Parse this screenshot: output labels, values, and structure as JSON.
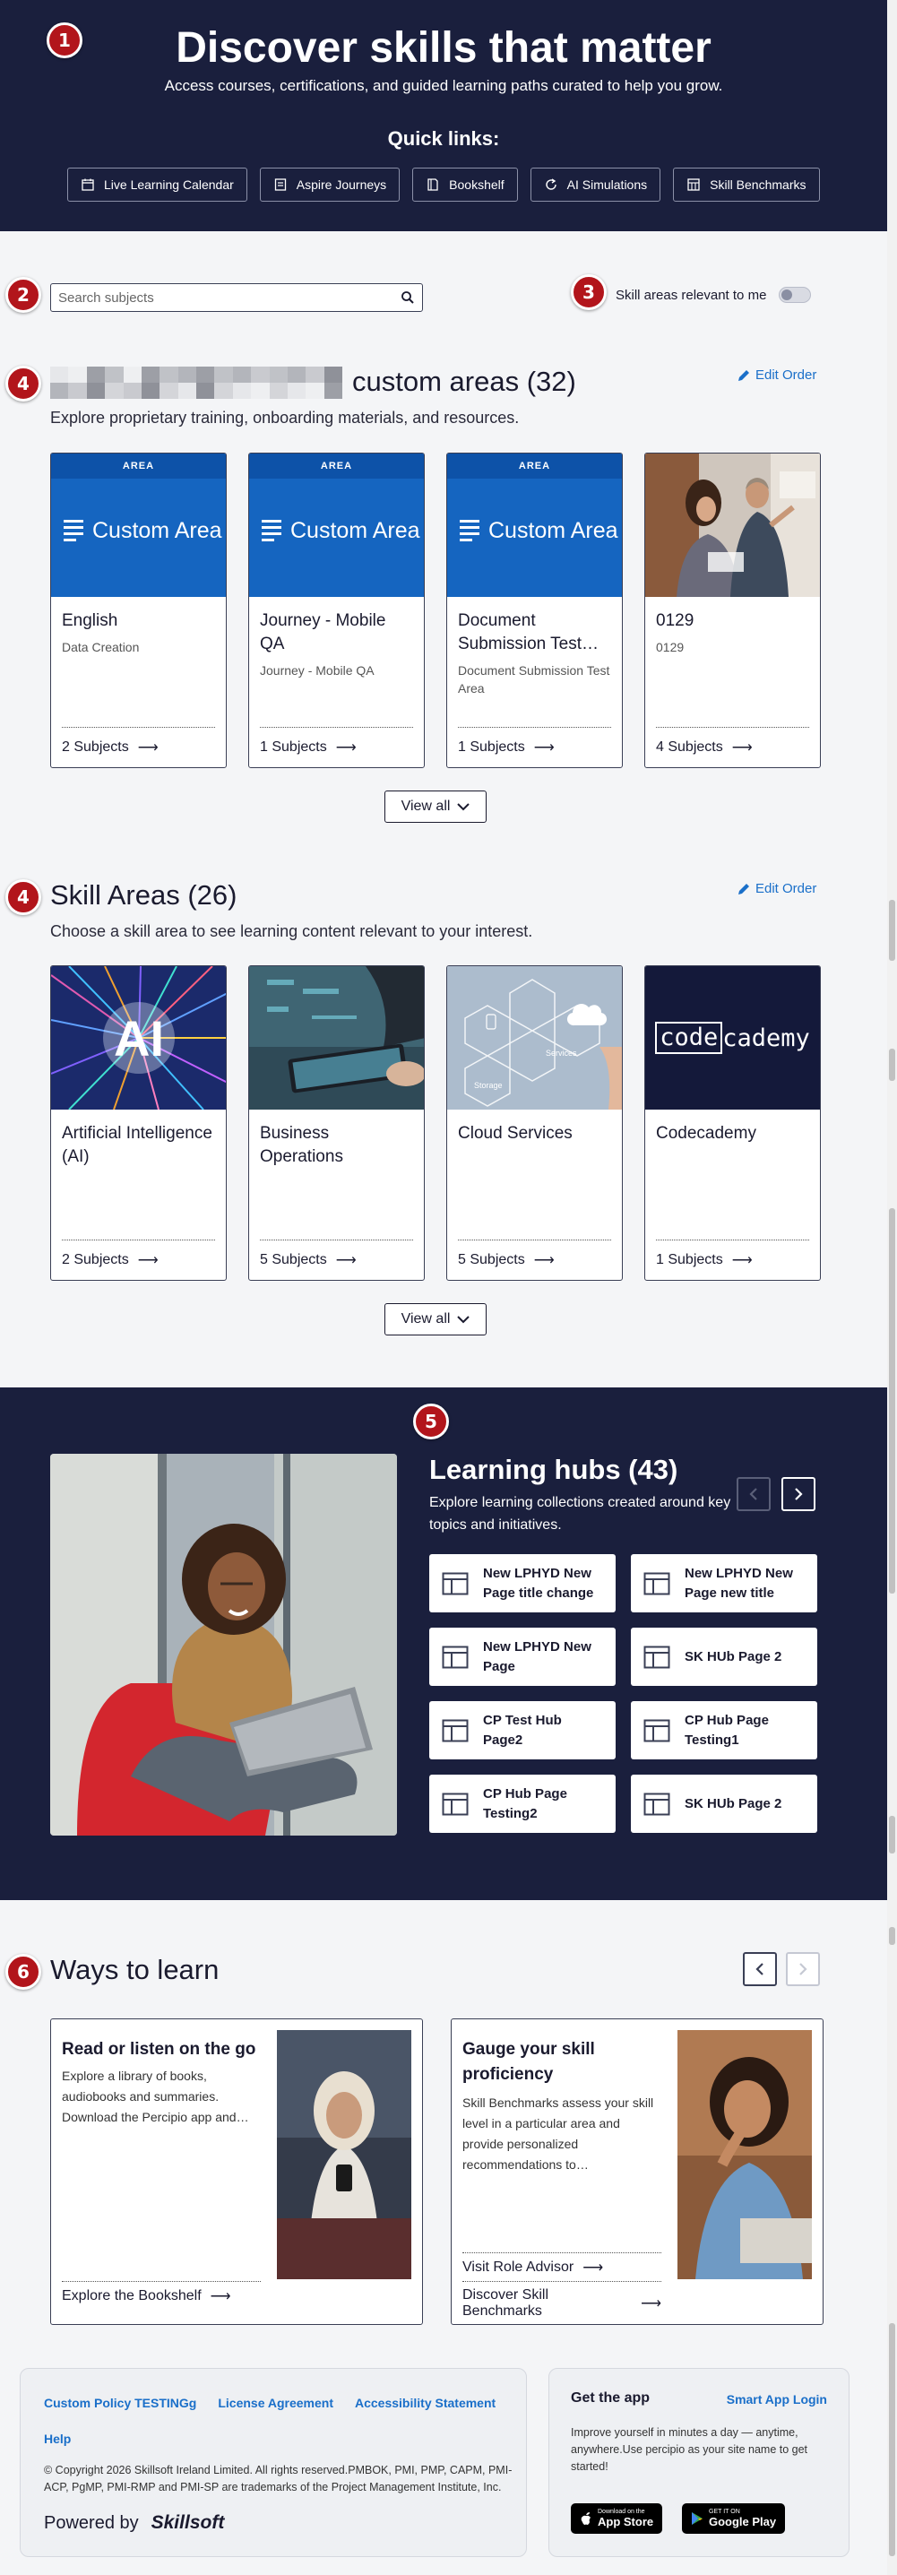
{
  "badges": [
    "1",
    "2",
    "3",
    "4",
    "4",
    "5",
    "6"
  ],
  "hero": {
    "title": "Discover skills that matter",
    "subtitle": "Access courses, certifications, and guided learning paths curated to help you grow.",
    "quick_links_title": "Quick links:",
    "quick_links": [
      {
        "label": "Live Learning Calendar",
        "icon": "calendar-icon"
      },
      {
        "label": "Aspire Journeys",
        "icon": "journey-icon"
      },
      {
        "label": "Bookshelf",
        "icon": "book-icon"
      },
      {
        "label": "AI Simulations",
        "icon": "refresh-icon"
      },
      {
        "label": "Skill Benchmarks",
        "icon": "benchmark-icon"
      }
    ]
  },
  "search": {
    "placeholder": "Search subjects"
  },
  "toggle": {
    "label": "Skill areas relevant to me",
    "on": false
  },
  "custom_areas": {
    "title": "custom areas (32)",
    "description": "Explore proprietary training, onboarding materials, and resources.",
    "edit_label": "Edit Order",
    "view_all_label": "View all",
    "cards": [
      {
        "strip": "AREA",
        "image_label": "Custom Area",
        "title": "English",
        "subtitle": "Data Creation",
        "subjects": "2 Subjects"
      },
      {
        "strip": "AREA",
        "image_label": "Custom Area",
        "title": "Journey - Mobile QA",
        "subtitle": "Journey - Mobile QA",
        "subjects": "1 Subjects"
      },
      {
        "strip": "AREA",
        "image_label": "Custom Area",
        "title": "Document Submission Test…",
        "subtitle": "Document Submission Test Area",
        "subjects": "1 Subjects"
      },
      {
        "title": "0129",
        "subtitle": "0129",
        "subjects": "4 Subjects"
      }
    ]
  },
  "skill_areas": {
    "title": "Skill Areas (26)",
    "description": "Choose a skill area to see learning content relevant to your interest.",
    "edit_label": "Edit Order",
    "view_all_label": "View all",
    "cards": [
      {
        "title": "Artificial Intelligence (AI)",
        "subjects": "2 Subjects",
        "image_text": "AI"
      },
      {
        "title": "Business Operations",
        "subjects": "5 Subjects"
      },
      {
        "title": "Cloud Services",
        "subjects": "5 Subjects",
        "image_labels": [
          "Services",
          "Storage"
        ]
      },
      {
        "title": "Codecademy",
        "subjects": "1 Subjects",
        "image_text_a": "code",
        "image_text_b": "cademy"
      }
    ]
  },
  "hubs": {
    "title": "Learning hubs (43)",
    "description": "Explore learning collections created around key topics and initiatives.",
    "items": [
      "New LPHYD New Page title change",
      "New LPHYD New Page new title",
      "New LPHYD New Page",
      "SK HUb Page 2",
      "CP Test Hub Page2",
      "CP Hub Page Testing1",
      "CP Hub Page Testing2",
      "SK HUb Page 2"
    ]
  },
  "ways": {
    "title": "Ways to learn",
    "cards": [
      {
        "title": "Read or listen on the go",
        "description": "Explore a library of books, audiobooks and summaries. Download the Percipio app and…",
        "links": [
          "Explore the Bookshelf"
        ]
      },
      {
        "title": "Gauge your skill proficiency",
        "description": "Skill Benchmarks assess your skill level in a particular area and provide personalized recommendations to…",
        "links": [
          "Visit Role Advisor",
          "Discover Skill Benchmarks"
        ]
      }
    ]
  },
  "footer": {
    "links": [
      "Custom Policy TESTINGg",
      "License Agreement",
      "Accessibility Statement"
    ],
    "help": "Help",
    "copyright": "© Copyright 2026 Skillsoft Ireland Limited. All rights reserved.PMBOK, PMI, PMP, CAPM, PMI-ACP, PgMP, PMI-RMP and PMI-SP are trademarks of the Project Management Institute, Inc.",
    "powered_by": "Powered by",
    "brand": "Skillsoft",
    "get_app": "Get the app",
    "smart_link": "Smart App Login",
    "app_desc": "Improve yourself in minutes a day — anytime, anywhere.Use percipio as your site name to get started!",
    "app_store_top": "Download on the",
    "app_store": "App Store",
    "play_top": "GET IT ON",
    "play": "Google Play"
  },
  "colors": {
    "navy": "#1a1f3d",
    "accent": "#1a6fc9",
    "badge": "#b2151b",
    "area_blue": "#1565c0"
  }
}
